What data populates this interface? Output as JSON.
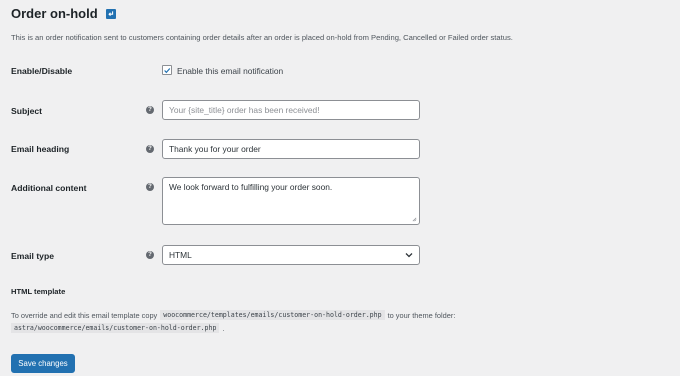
{
  "header": {
    "title": "Order on-hold",
    "back_icon": "return-arrow-icon",
    "description": "This is an order notification sent to customers containing order details after an order is placed on-hold from Pending, Cancelled or Failed order status."
  },
  "fields": {
    "enable": {
      "label": "Enable/Disable",
      "checkbox_label": "Enable this email notification",
      "checked": true
    },
    "subject": {
      "label": "Subject",
      "value": "",
      "placeholder": "Your {site_title} order has been received!"
    },
    "heading": {
      "label": "Email heading",
      "value": "Thank you for your order"
    },
    "additional": {
      "label": "Additional content",
      "value": "We look forward to fulfilling your order soon."
    },
    "email_type": {
      "label": "Email type",
      "selected": "HTML"
    }
  },
  "template": {
    "heading": "HTML template",
    "text_before": "To override and edit this email template copy",
    "source_path": "woocommerce/templates/emails/customer-on-hold-order.php",
    "text_middle": "to your theme folder:",
    "dest_path": "astra/woocommerce/emails/customer-on-hold-order.php",
    "text_after": "."
  },
  "actions": {
    "save_label": "Save changes"
  },
  "colors": {
    "accent": "#2271b1",
    "background": "#f0f0f1"
  }
}
